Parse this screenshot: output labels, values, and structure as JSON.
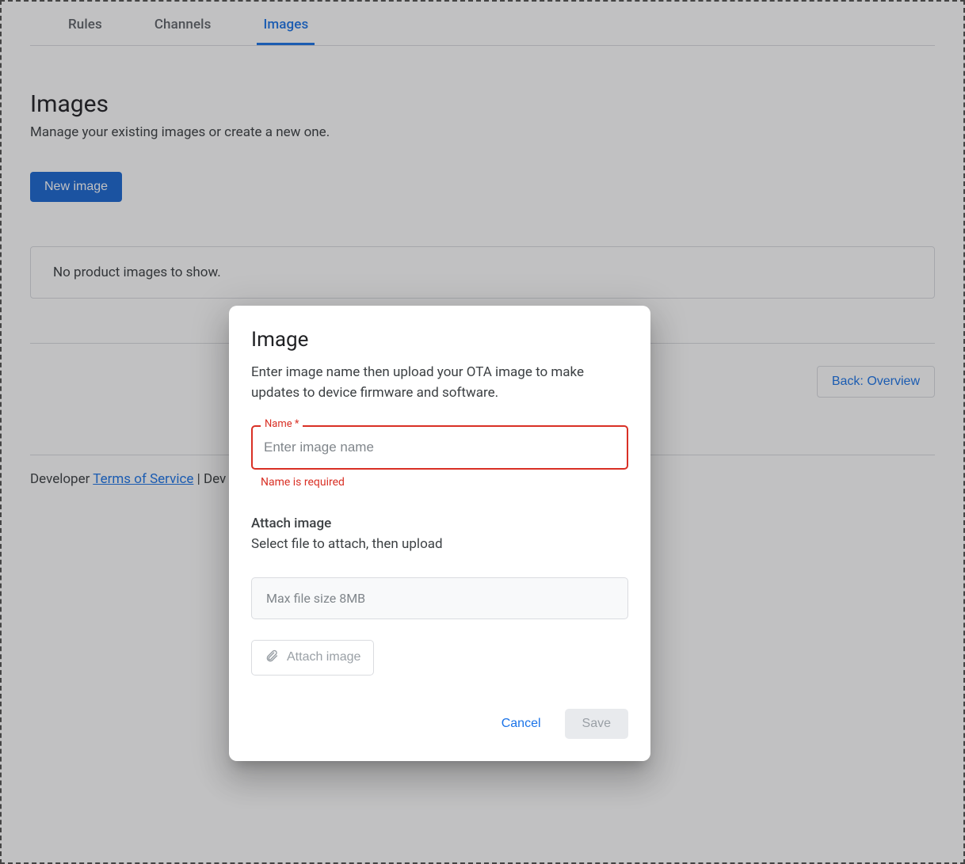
{
  "tabs": {
    "rules": "Rules",
    "channels": "Channels",
    "images": "Images"
  },
  "page": {
    "title": "Images",
    "subtitle": "Manage your existing images or create a new one.",
    "new_image": "New image",
    "empty": "No product images to show.",
    "back": "Back: Overview"
  },
  "footer": {
    "prefix": "Developer ",
    "tos": "Terms of Service",
    "sep": " | Dev"
  },
  "dialog": {
    "title": "Image",
    "desc": "Enter image name then upload your OTA image to make updates to device firmware and software.",
    "name_label": "Name *",
    "name_placeholder": "Enter image name",
    "name_error": "Name is required",
    "attach_title": "Attach image",
    "attach_desc": "Select file to attach, then upload",
    "file_hint": "Max file size 8MB",
    "attach_btn": "Attach image",
    "cancel": "Cancel",
    "save": "Save"
  }
}
